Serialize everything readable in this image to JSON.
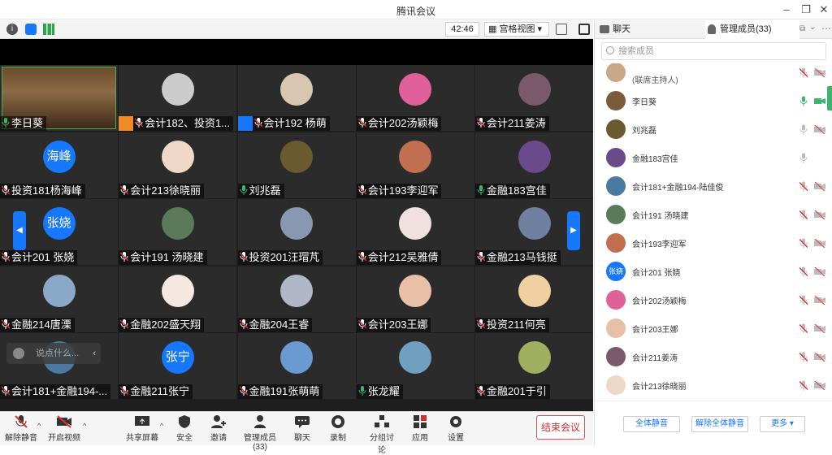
{
  "window": {
    "title": "腾讯会议"
  },
  "video_toolbar": {
    "timer": "42:46",
    "view_mode": "宫格视图"
  },
  "tiles": [
    {
      "name": "李日葵",
      "mic": "on",
      "type": "selfcam"
    },
    {
      "name": "会计182、投资1...",
      "mic": "muted",
      "type": "photo",
      "host_badge": true,
      "color": "#cccccc"
    },
    {
      "name": "会计192 杨萌",
      "mic": "muted",
      "type": "photo",
      "host_badge": true,
      "color": "#d8c6b0"
    },
    {
      "name": "会计202汤颖梅",
      "mic": "muted",
      "type": "photo",
      "color": "#e0609a"
    },
    {
      "name": "会计211姜涛",
      "mic": "muted",
      "type": "photo",
      "color": "#7a5a6a"
    },
    {
      "name": "投资181杨海峰",
      "mic": "muted",
      "type": "text",
      "avatar_text": "海峰"
    },
    {
      "name": "会计213徐晓丽",
      "mic": "muted",
      "type": "photo",
      "color": "#f0d8c8"
    },
    {
      "name": "刘兆磊",
      "mic": "on",
      "type": "photo",
      "color": "#6a5a30"
    },
    {
      "name": "会计193李迎军",
      "mic": "muted",
      "type": "photo",
      "color": "#c07050"
    },
    {
      "name": "金融183宫佳",
      "mic": "on",
      "type": "photo",
      "color": "#6a4a8a"
    },
    {
      "name": "会计201 张娆",
      "mic": "muted",
      "type": "text",
      "avatar_text": "张娆"
    },
    {
      "name": "会计191 汤晓建",
      "mic": "muted",
      "type": "photo",
      "color": "#5a7a5a"
    },
    {
      "name": "投资201汪瑁芃",
      "mic": "muted",
      "type": "photo",
      "color": "#8898b0"
    },
    {
      "name": "会计212吴雅倩",
      "mic": "muted",
      "type": "photo",
      "color": "#f0e0e0"
    },
    {
      "name": "金融213马钱挺",
      "mic": "muted",
      "type": "photo",
      "color": "#7080a0"
    },
    {
      "name": "金融214唐溧",
      "mic": "muted",
      "type": "photo",
      "color": "#8aa8c8"
    },
    {
      "name": "金融202盛天翔",
      "mic": "muted",
      "type": "photo",
      "color": "#f5e8e0"
    },
    {
      "name": "金融204王睿",
      "mic": "muted",
      "type": "photo",
      "color": "#b0b8c8"
    },
    {
      "name": "会计203王娜",
      "mic": "muted",
      "type": "photo",
      "color": "#e8c0a8"
    },
    {
      "name": "投资211何亮",
      "mic": "muted",
      "type": "photo",
      "color": "#f0d0a0"
    },
    {
      "name": "会计181+金融194-...",
      "mic": "muted",
      "type": "photo",
      "color": "#4a7aa0"
    },
    {
      "name": "金融211张宁",
      "mic": "muted",
      "type": "text",
      "avatar_text": "张宁"
    },
    {
      "name": "金融191张萌萌",
      "mic": "muted",
      "type": "photo",
      "color": "#6a9ad0"
    },
    {
      "name": "张龙耀",
      "mic": "on",
      "type": "photo",
      "color": "#70a0c0"
    },
    {
      "name": "金融201于引",
      "mic": "muted",
      "type": "photo",
      "color": "#a0b060"
    }
  ],
  "chat_bubble": {
    "placeholder": "说点什么..."
  },
  "bottom_bar": {
    "unmute": "解除静音",
    "start_video": "开启视频",
    "share_screen": "共享屏幕",
    "security": "安全",
    "invite": "邀请",
    "manage_members": "管理成员(33)",
    "chat": "聊天",
    "record": "录制",
    "breakout": "分组讨论",
    "apps": "应用",
    "settings": "设置",
    "end_meeting": "结束会议"
  },
  "side_panel": {
    "tab_chat": "聊天",
    "tab_members": "管理成员(33)",
    "search_placeholder": "搜索成员",
    "members": [
      {
        "name": "",
        "subtitle": "(联席主持人)",
        "mic": "muted",
        "cam": "off",
        "color": "#c8a888"
      },
      {
        "name": "李日葵",
        "mic": "on",
        "cam": "on",
        "color": "#7a5a3a"
      },
      {
        "name": "刘兆磊",
        "mic": "unmuted",
        "cam": "off",
        "color": "#6a5a30"
      },
      {
        "name": "金融183宫佳",
        "mic": "unmuted",
        "cam": "none",
        "color": "#6a4a8a"
      },
      {
        "name": "会计181+金融194-陆佳俊",
        "mic": "muted",
        "cam": "off",
        "color": "#4a7aa0"
      },
      {
        "name": "会计191 汤晓建",
        "mic": "muted",
        "cam": "off",
        "color": "#5a7a5a"
      },
      {
        "name": "会计193李迎军",
        "mic": "muted",
        "cam": "off",
        "color": "#c07050"
      },
      {
        "name": "会计201 张娆",
        "mic": "muted",
        "cam": "off",
        "avatar_text": "张娆"
      },
      {
        "name": "会计202汤颖梅",
        "mic": "muted",
        "cam": "off",
        "color": "#e0609a"
      },
      {
        "name": "会计203王娜",
        "mic": "muted",
        "cam": "off",
        "color": "#e8c0a8"
      },
      {
        "name": "会计211姜涛",
        "mic": "muted",
        "cam": "off",
        "color": "#7a5a6a"
      },
      {
        "name": "会计213徐晓丽",
        "mic": "muted",
        "cam": "off",
        "color": "#f0d8c8"
      }
    ],
    "mute_all": "全体静音",
    "unmute_all": "解除全体静音",
    "more": "更多"
  }
}
